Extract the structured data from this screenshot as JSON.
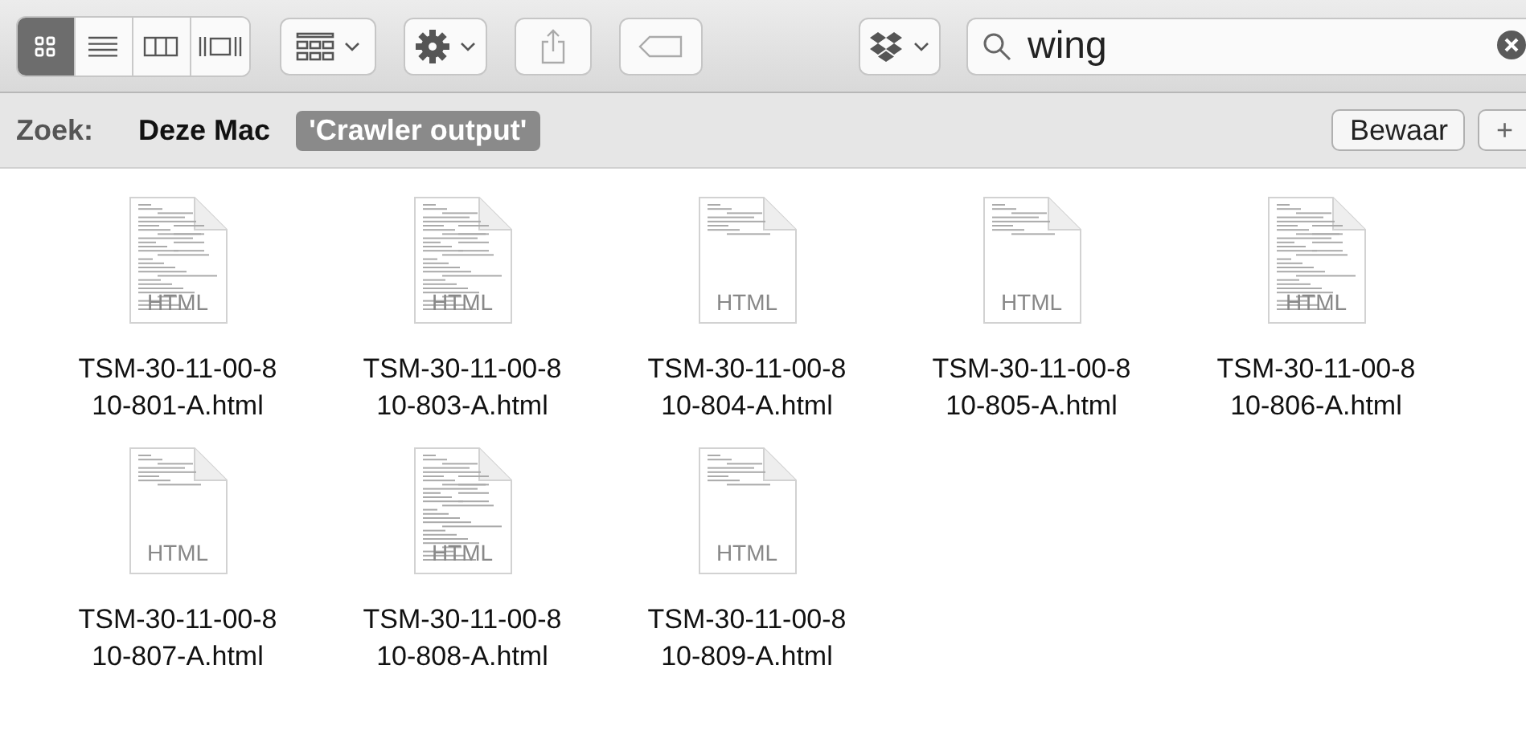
{
  "toolbar": {
    "view_modes": [
      {
        "kind": "icons",
        "selected": true
      },
      {
        "kind": "list",
        "selected": false
      },
      {
        "kind": "columns",
        "selected": false
      },
      {
        "kind": "coverflow",
        "selected": false
      }
    ],
    "search": {
      "value": "wing"
    }
  },
  "scope_bar": {
    "label": "Zoek:",
    "scopes": [
      {
        "label": "Deze Mac",
        "selected": false
      },
      {
        "label": "'Crawler output'",
        "selected": true
      }
    ],
    "save_button": "Bewaar",
    "add_button": "+"
  },
  "files": [
    {
      "name_lines": [
        "TSM-30-11-00-8",
        "10-801-A.html"
      ],
      "badge": "HTML",
      "kind": "dense"
    },
    {
      "name_lines": [
        "TSM-30-11-00-8",
        "10-803-A.html"
      ],
      "badge": "HTML",
      "kind": "dense"
    },
    {
      "name_lines": [
        "TSM-30-11-00-8",
        "10-804-A.html"
      ],
      "badge": "HTML",
      "kind": "sparse"
    },
    {
      "name_lines": [
        "TSM-30-11-00-8",
        "10-805-A.html"
      ],
      "badge": "HTML",
      "kind": "sparse"
    },
    {
      "name_lines": [
        "TSM-30-11-00-8",
        "10-806-A.html"
      ],
      "badge": "HTML",
      "kind": "dense"
    },
    {
      "name_lines": [
        "TSM-30-11-00-8",
        "10-807-A.html"
      ],
      "badge": "HTML",
      "kind": "sparse"
    },
    {
      "name_lines": [
        "TSM-30-11-00-8",
        "10-808-A.html"
      ],
      "badge": "HTML",
      "kind": "dense"
    },
    {
      "name_lines": [
        "TSM-30-11-00-8",
        "10-809-A.html"
      ],
      "badge": "HTML",
      "kind": "sparse"
    }
  ]
}
